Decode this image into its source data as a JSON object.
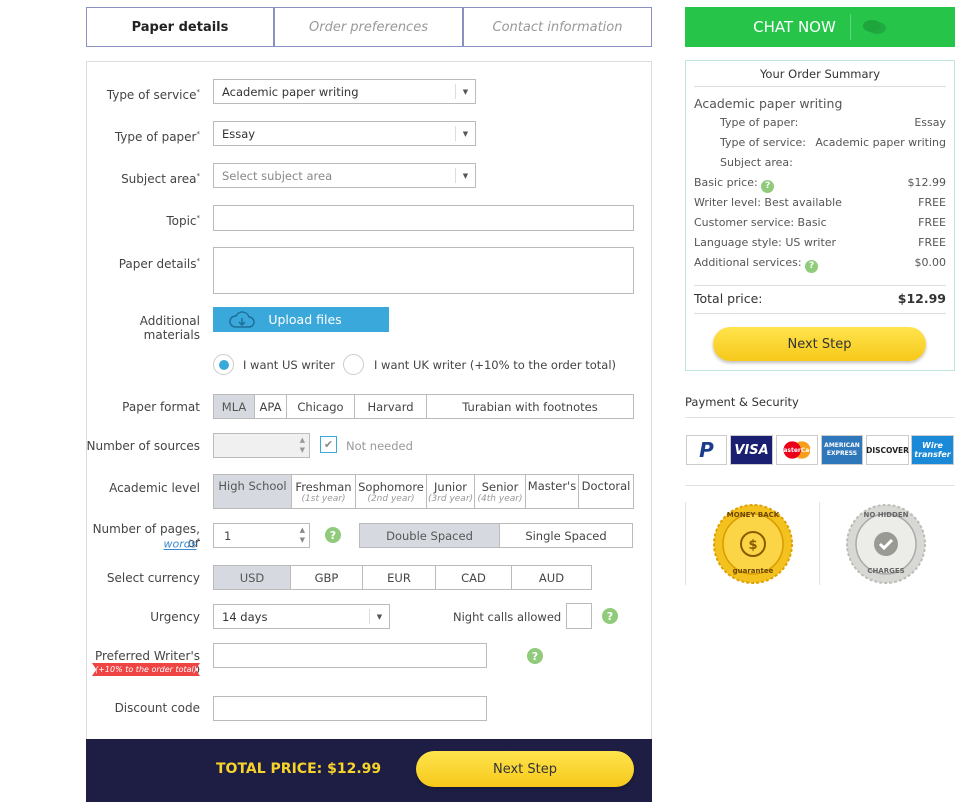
{
  "tabs": [
    "Paper details",
    "Order preferences",
    "Contact information"
  ],
  "form": {
    "type_of_service": {
      "label": "Type of service",
      "value": "Academic paper writing"
    },
    "type_of_paper": {
      "label": "Type of paper",
      "value": "Essay"
    },
    "subject_area": {
      "label": "Subject area",
      "value": "Select subject area"
    },
    "topic": {
      "label": "Topic"
    },
    "paper_details": {
      "label": "Paper details"
    },
    "additional_materials": {
      "label": "Additional materials",
      "button": "Upload files"
    },
    "writer": {
      "us": "I want US writer",
      "uk": "I want UK writer (+10% to the order total)"
    },
    "paper_format": {
      "label": "Paper format",
      "options": [
        "MLA",
        "APA",
        "Chicago",
        "Harvard",
        "Turabian with footnotes"
      ]
    },
    "sources": {
      "label": "Number of sources",
      "not_needed": "Not needed"
    },
    "academic_level": {
      "label": "Academic level",
      "options": [
        {
          "name": "High School",
          "sub": ""
        },
        {
          "name": "Freshman",
          "sub": "(1st year)"
        },
        {
          "name": "Sophomore",
          "sub": "(2nd year)"
        },
        {
          "name": "Junior",
          "sub": "(3rd year)"
        },
        {
          "name": "Senior",
          "sub": "(4th year)"
        },
        {
          "name": "Master's",
          "sub": ""
        },
        {
          "name": "Doctoral",
          "sub": ""
        }
      ]
    },
    "pages": {
      "label": "Number of pages, or",
      "words_link": "words",
      "value": "1",
      "spacing": [
        "Double Spaced",
        "Single Spaced"
      ]
    },
    "currency": {
      "label": "Select currency",
      "options": [
        "USD",
        "GBP",
        "EUR",
        "CAD",
        "AUD"
      ]
    },
    "urgency": {
      "label": "Urgency",
      "value": "14 days",
      "night_calls": "Night calls allowed"
    },
    "writer_id": {
      "label": "Preferred Writer's ID",
      "badge": "(+10% to the order total)"
    },
    "discount": {
      "label": "Discount code"
    },
    "help_glyph": "?"
  },
  "footer": {
    "total_label": "TOTAL PRICE: $12.99",
    "next": "Next Step"
  },
  "chat": {
    "label": "CHAT NOW"
  },
  "summary": {
    "title": "Your Order Summary",
    "service": "Academic paper writing",
    "type_of_paper_label": "Type of paper:",
    "type_of_paper_value": "Essay",
    "type_of_service_label": "Type of service:",
    "type_of_service_value": "Academic paper writing",
    "subject_label": "Subject area:",
    "basic_price_label": "Basic price:",
    "basic_price_value": "$12.99",
    "writer_level_label": "Writer level: Best available",
    "writer_level_value": "FREE",
    "customer_service_label": "Customer service: Basic",
    "customer_service_value": "FREE",
    "language_label": "Language style: US writer",
    "language_value": "FREE",
    "additional_label": "Additional services:",
    "additional_value": "$0.00",
    "total_label": "Total price:",
    "total_value": "$12.99",
    "next": "Next Step"
  },
  "payment": {
    "title": "Payment & Security",
    "cards": [
      "P",
      "VISA",
      "MasterCard",
      "AMERICAN EXPRESS",
      "DISCOVER",
      "Wire transfer"
    ],
    "badges": {
      "money_back": [
        "MONEY BACK",
        "guarantee"
      ],
      "no_hidden": [
        "NO HIDDEN",
        "CHARGES"
      ]
    }
  },
  "colors": {
    "chat_green": "#27c44a",
    "dark_footer": "#1e1e45",
    "yellow": "#f8d42a",
    "upload_blue": "#3ba8dc",
    "help_green": "#8fcb7a"
  }
}
